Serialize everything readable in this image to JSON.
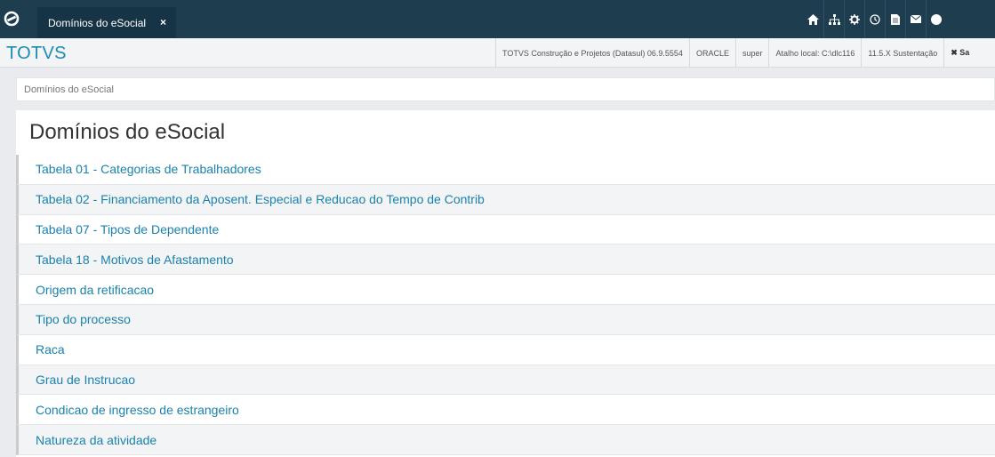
{
  "topbar": {
    "tab_label": "Domínios do eSocial",
    "tab_close": "×",
    "icons": [
      "home-icon",
      "sitemap-icon",
      "gear-icon",
      "clock-icon",
      "document-icon",
      "mail-icon"
    ]
  },
  "statusbar": {
    "brand": "TOTVS",
    "items": [
      "TOTVS Construção e Projetos (Datasul) 06.9.5554",
      "ORACLE",
      "super",
      "Atalho local: C:\\dlc116",
      "11.5.X Sustentação",
      "✖ Sa"
    ]
  },
  "breadcrumb": "Domínios do eSocial",
  "page": {
    "title": "Domínios do eSocial",
    "items": [
      "Tabela 01 - Categorias de Trabalhadores",
      "Tabela 02 - Financiamento da Aposent. Especial e Reducao do Tempo de Contrib",
      "Tabela 07 - Tipos de Dependente",
      "Tabela 18 - Motivos de Afastamento",
      "Origem da retificacao",
      "Tipo do processo",
      "Raca",
      "Grau de Instrucao",
      "Condicao de ingresso de estrangeiro",
      "Natureza da atividade"
    ]
  },
  "colors": {
    "topbar": "#1e3d4f",
    "accent": "#1b8bb3",
    "link": "#1a82ad"
  }
}
